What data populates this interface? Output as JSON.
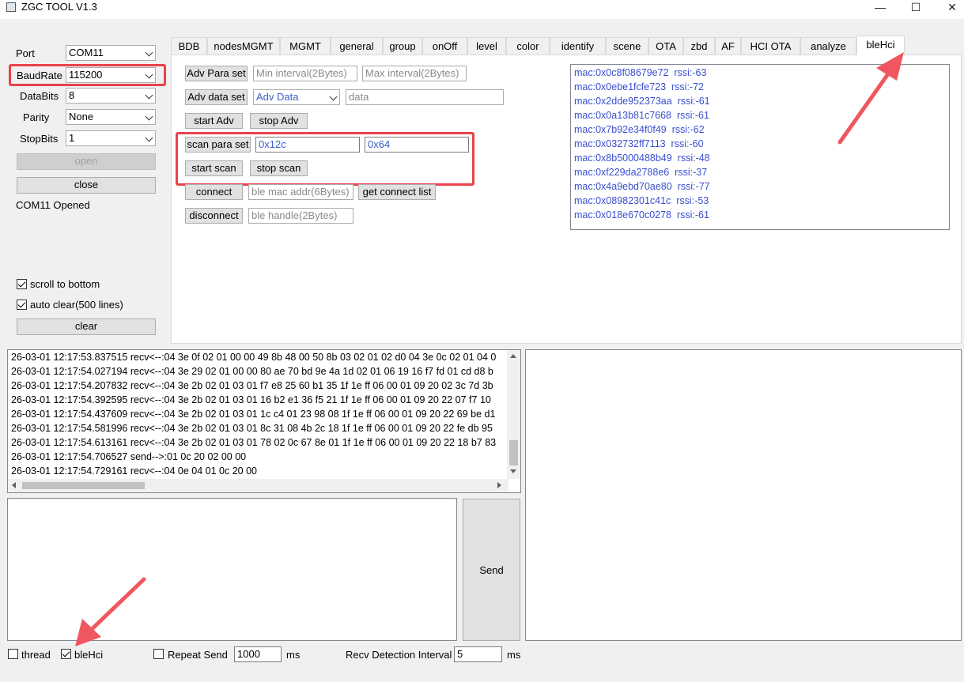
{
  "window": {
    "title": "ZGC TOOL V1.3",
    "min": "—",
    "max": "☐",
    "close": "✕"
  },
  "left": {
    "port_label": "Port",
    "port_value": "COM11",
    "baud_label": "BaudRate",
    "baud_value": "115200",
    "databits_label": "DataBits",
    "databits_value": "8",
    "parity_label": "Parity",
    "parity_value": "None",
    "stopbits_label": "StopBits",
    "stopbits_value": "1",
    "open_label": "open",
    "close_label": "close",
    "status": "COM11 Opened",
    "scroll_label": "scroll to bottom",
    "autoclear_label": "auto clear(500 lines)",
    "clear_label": "clear"
  },
  "tabs": [
    "BDB",
    "nodesMGMT",
    "MGMT",
    "general",
    "group",
    "onOff",
    "level",
    "color",
    "identify",
    "scene",
    "OTA",
    "zbd",
    "AF",
    "HCI OTA",
    "analyze",
    "bleHci"
  ],
  "active_tab": "bleHci",
  "ble": {
    "adv_para_set": "Adv Para set",
    "min_interval_ph": "Min interval(2Bytes)",
    "max_interval_ph": "Max interval(2Bytes)",
    "adv_data_set": "Adv data set",
    "adv_data_select": "Adv Data",
    "data_ph": "data",
    "start_adv": "start Adv",
    "stop_adv": "stop Adv",
    "scan_para_set": "scan para set",
    "scan_interval": "0x12c",
    "scan_window": "0x64",
    "start_scan": "start scan",
    "stop_scan": "stop scan",
    "connect": "connect",
    "mac_ph": "ble mac addr(6Bytes)",
    "get_connect_list": "get connect list",
    "disconnect": "disconnect",
    "handle_ph": "ble handle(2Bytes)"
  },
  "devices": [
    "mac:0x0c8f08679e72  rssi:-63",
    "mac:0x0ebe1fcfe723  rssi:-72",
    "mac:0x2dde952373aa  rssi:-61",
    "mac:0x0a13b81c7668  rssi:-61",
    "mac:0x7b92e34f0f49  rssi:-62",
    "mac:0x032732ff7113  rssi:-60",
    "mac:0x8b5000488b49  rssi:-48",
    "mac:0xf229da2788e6  rssi:-37",
    "mac:0x4a9ebd70ae80  rssi:-77",
    "mac:0x08982301c41c  rssi:-53",
    "mac:0x018e670c0278  rssi:-61"
  ],
  "log": [
    "26-03-01 12:17:53.837515 recv<--:04 3e 0f 02 01 00 00 49 8b 48 00 50 8b 03 02 01 02 d0 04 3e 0c 02 01 04 0",
    "26-03-01 12:17:54.027194 recv<--:04 3e 29 02 01 00 00 80 ae 70 bd 9e 4a 1d 02 01 06 19 16 f7 fd 01 cd d8 b",
    "26-03-01 12:17:54.207832 recv<--:04 3e 2b 02 01 03 01 f7 e8 25 60 b1 35 1f 1e ff 06 00 01 09 20 02 3c 7d 3b",
    "26-03-01 12:17:54.392595 recv<--:04 3e 2b 02 01 03 01 16 b2 e1 36 f5 21 1f 1e ff 06 00 01 09 20 22 07 f7 10",
    "26-03-01 12:17:54.437609 recv<--:04 3e 2b 02 01 03 01 1c c4 01 23 98 08 1f 1e ff 06 00 01 09 20 22 69 be d1",
    "26-03-01 12:17:54.581996 recv<--:04 3e 2b 02 01 03 01 8c 31 08 4b 2c 18 1f 1e ff 06 00 01 09 20 22 fe db 95",
    "26-03-01 12:17:54.613161 recv<--:04 3e 2b 02 01 03 01 78 02 0c 67 8e 01 1f 1e ff 06 00 01 09 20 22 18 b7 83",
    "26-03-01 12:17:54.706527 send-->:01 0c 20 02 00 00",
    "26-03-01 12:17:54.729161 recv<--:04 0e 04 01 0c 20 00"
  ],
  "send_label": "Send",
  "bottom": {
    "thread_label": "thread",
    "blehci_label": "bleHci",
    "repeat_label": "Repeat Send",
    "repeat_value": "1000",
    "ms1": "ms",
    "recv_label": "Recv Detection Interval",
    "recv_value": "5",
    "ms2": "ms"
  }
}
